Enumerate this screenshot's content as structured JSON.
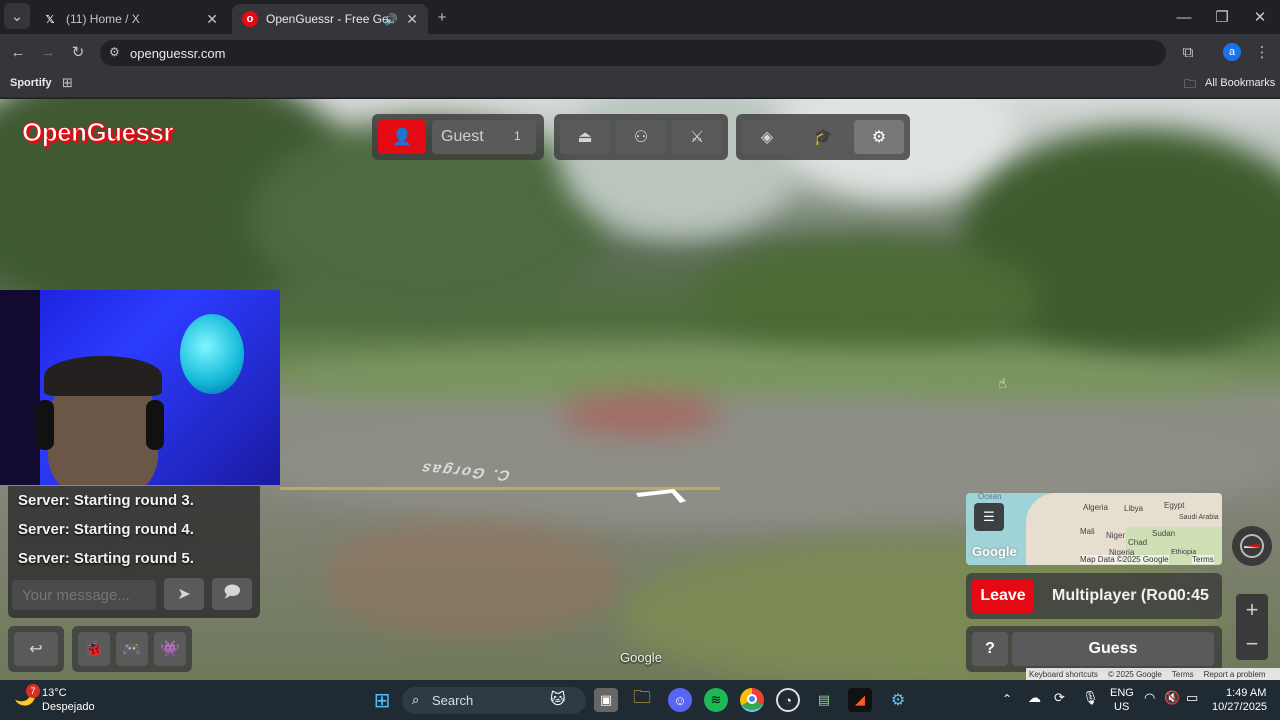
{
  "browser": {
    "tabs": [
      {
        "title": "(11) Home / X",
        "icon": "x-logo-icon"
      },
      {
        "title": "OpenGuessr - Free GeoGue",
        "icon": "openguessr-icon"
      }
    ],
    "address": "openguessr.com",
    "bookmarks": [
      "Sportify"
    ],
    "all_bookmarks": "All Bookmarks",
    "profile_initial": "a"
  },
  "game": {
    "logo": "OpenGuessr",
    "player": {
      "name": "Guest",
      "count": "1"
    },
    "chat": [
      "Server: Starting round 3.",
      "Server: Starting round 4.",
      "Server: Starting round 5."
    ],
    "chat_placeholder": "Your message...",
    "street_label": "C. Gorgas",
    "google_watermark": "Google",
    "minimap": {
      "ocean_label": "Ocean",
      "countries": [
        "Algeria",
        "Libya",
        "Egypt",
        "Saudi Arabia",
        "Mali",
        "Niger",
        "Sudan",
        "Chad",
        "Nigeria",
        "Ethiopia"
      ],
      "google": "Google",
      "map_data": "Map Data ©2025 Google",
      "terms": "Terms"
    },
    "leave_label": "Leave",
    "mode_label": "Multiplayer (Rou",
    "timer": "00:45",
    "help_label": "?",
    "guess_label": "Guess",
    "footer": [
      "Keyboard shortcuts",
      "© 2025 Google",
      "Terms",
      "Report a problem"
    ]
  },
  "taskbar": {
    "weather_temp": "13°C",
    "weather_desc": "Despejado",
    "weather_badge": "7",
    "search_placeholder": "Search",
    "lang": "ENG",
    "region": "US",
    "time": "1:49 AM",
    "date": "10/27/2025"
  },
  "colors": {
    "accent_red": "#e50914",
    "panel": "#3c3c3c"
  }
}
